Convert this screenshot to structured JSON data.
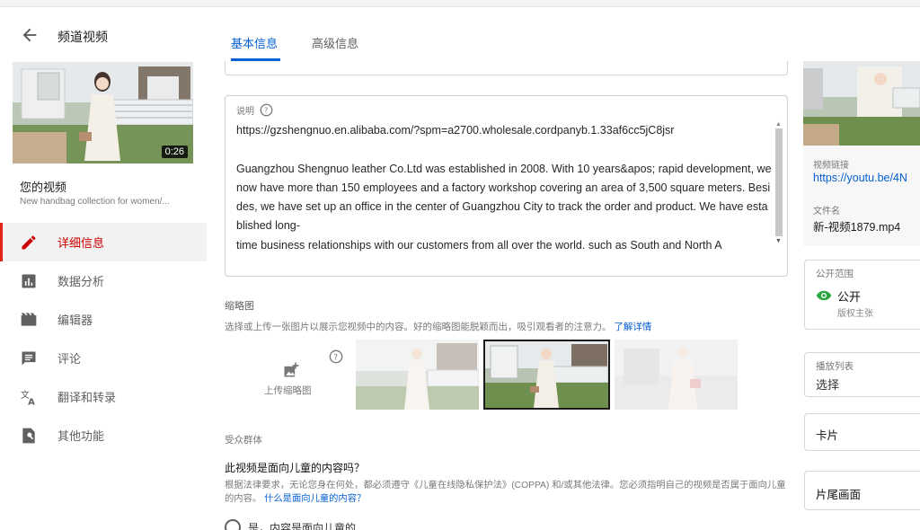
{
  "sidebar": {
    "back_title": "频道视频",
    "thumbnail_duration": "0:26",
    "your_video_label": "您的视频",
    "video_description": "New handbag collection for women/...",
    "items": [
      {
        "label": "详细信息",
        "icon": "pencil-icon",
        "active": true
      },
      {
        "label": "数据分析",
        "icon": "analytics-icon",
        "active": false
      },
      {
        "label": "编辑器",
        "icon": "editor-icon",
        "active": false
      },
      {
        "label": "评论",
        "icon": "comment-icon",
        "active": false
      },
      {
        "label": "翻译和转录",
        "icon": "translate-icon",
        "active": false
      },
      {
        "label": "其他功能",
        "icon": "other-features-icon",
        "active": false
      }
    ]
  },
  "tabs": [
    {
      "label": "基本信息",
      "active": true
    },
    {
      "label": "高级信息",
      "active": false
    }
  ],
  "description": {
    "label": "说明",
    "text": "https://gzshengnuo.en.alibaba.com/?spm=a2700.wholesale.cordpanyb.1.33af6cc5jC8jsr\n\nGuangzhou Shengnuo leather Co.Ltd was established in 2008. With 10 years&apos; rapid development, we now have more than 150 employees and a factory workshop covering an area of 3,500 square meters. Besides, we have set up an office in the center of Guangzhou City to track the order and product. We have established long-\ntime business relationships with our customers from all over the world. such as South and North A"
  },
  "thumbnails": {
    "label": "缩略图",
    "help_text": "选择或上传一张图片以展示您视频中的内容。好的缩略图能脱颖而出，吸引观看者的注意力。",
    "help_link": "了解详情",
    "upload_label": "上传缩略图"
  },
  "audience": {
    "label": "受众群体",
    "question": "此视频是面向儿童的内容吗？",
    "text": "根据法律要求，无论您身在何处，都必须遵守《儿童在线隐私保护法》(COPPA) 和/或其他法律。您必须指明自己的视频是否属于面向儿童的内容。",
    "link": "什么是面向儿童的内容？",
    "option_yes": "是，内容是面向儿童的"
  },
  "right_panel": {
    "video_link_label": "视频链接",
    "video_link": "https://youtu.be/4N",
    "file_name_label": "文件名",
    "file_name": "新-视频1879.mp4",
    "visibility_label": "公开范围",
    "visibility_value": "公开",
    "visibility_sub": "版权主张",
    "playlist_label": "播放列表",
    "playlist_value": "选择",
    "cards_label": "卡片",
    "end_screen_label": "片尾画面"
  },
  "colors": {
    "accent_blue": "#065fd4",
    "active_red": "#cc0000",
    "eye_green": "#2ba640"
  }
}
